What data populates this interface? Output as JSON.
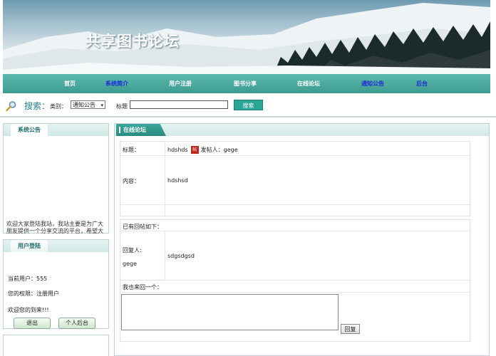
{
  "banner": {
    "title": "共享图书论坛"
  },
  "nav": {
    "items": [
      {
        "label": "首页"
      },
      {
        "label": "系统简介"
      },
      {
        "label": "用户注册"
      },
      {
        "label": "图书分享"
      },
      {
        "label": "在线论坛"
      },
      {
        "label": "通知公告"
      },
      {
        "label": "后台"
      }
    ]
  },
  "search": {
    "label": "搜索：",
    "type_label": "类别：",
    "type_value": "通知公告",
    "title_label": "标题",
    "title_value": "",
    "button": "搜索"
  },
  "notice_panel": {
    "title": "系统公告",
    "text": "欢迎大家登陆我站，我站主要是为广大朋友提供一个分享交流的平台，希望大家喜欢"
  },
  "login_panel": {
    "title": "用户登陆",
    "current_user": "当前用户：555",
    "permission": "您的权限：注册用户",
    "welcome": "欢迎您的到来!!!",
    "logout_button": "退出",
    "backend_button": "个人后台"
  },
  "forum": {
    "tab": "在线论坛",
    "title_label": "标题：",
    "title_value": "hdshds",
    "poster_label": "发帖人：",
    "poster": "gege",
    "content_label": "内容：",
    "content_value": "hdshsd",
    "replies_label": "已有回帖如下：",
    "replier_label": "回复人:",
    "replier": "gege",
    "reply_content": "sdgsdgsd",
    "my_reply_label": "我也来回一个：",
    "reply_textarea_value": "",
    "reply_button": "回复"
  },
  "colors": {
    "nav_bg": "#3d9b90",
    "nav_blue_text": "#1f2bd6",
    "accent": "#2aa596"
  },
  "icons": [
    "search-magnifier-icon",
    "poster-badge-icon",
    "textarea-resize-grip-icon"
  ]
}
